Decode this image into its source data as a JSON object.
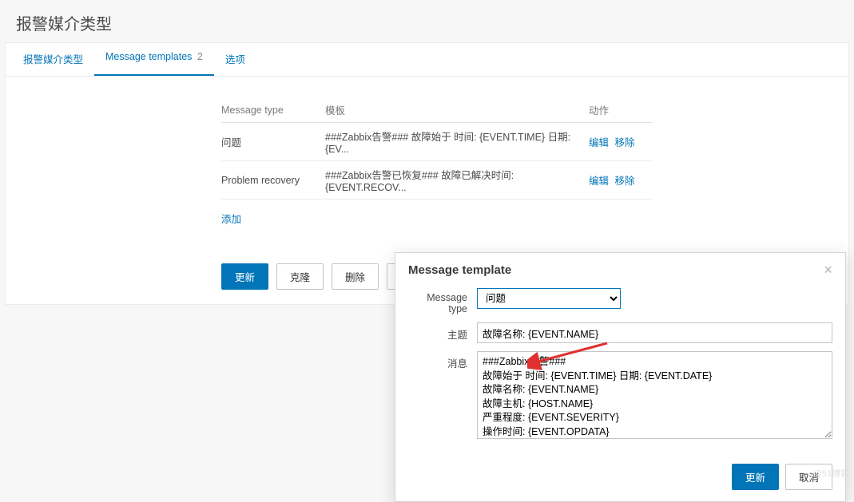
{
  "page": {
    "title": "报警媒介类型"
  },
  "tabs": {
    "t1": "报警媒介类型",
    "t2": "Message templates",
    "t2_count": "2",
    "t3": "选项"
  },
  "table": {
    "headers": {
      "type": "Message type",
      "template": "模板",
      "actions": "动作"
    },
    "rows": [
      {
        "type": "问题",
        "template": "###Zabbix告警### 故障始于 时间: {EVENT.TIME} 日期: {EV...",
        "edit": "编辑",
        "remove": "移除"
      },
      {
        "type": "Problem recovery",
        "template": "###Zabbix告警已恢复### 故障已解决时间: {EVENT.RECOV...",
        "edit": "编辑",
        "remove": "移除"
      }
    ],
    "add": "添加"
  },
  "buttons": {
    "update": "更新",
    "clone": "克隆",
    "delete": "删除",
    "cancel": "取消"
  },
  "modal": {
    "title": "Message template",
    "labels": {
      "type": "Message type",
      "subject": "主题",
      "message": "消息"
    },
    "type_value": "问题",
    "subject_value": "故障名称: {EVENT.NAME}",
    "message_value": "###Zabbix告警###\n故障始于 时间: {EVENT.TIME} 日期: {EVENT.DATE}\n故障名称: {EVENT.NAME}\n故障主机: {HOST.NAME}\n严重程度: {EVENT.SEVERITY}\n操作时间: {EVENT.OPDATA}\n问题起源ID: {EVENT.ID}",
    "update": "更新",
    "cancel": "取消"
  },
  "watermark": "@51博客"
}
